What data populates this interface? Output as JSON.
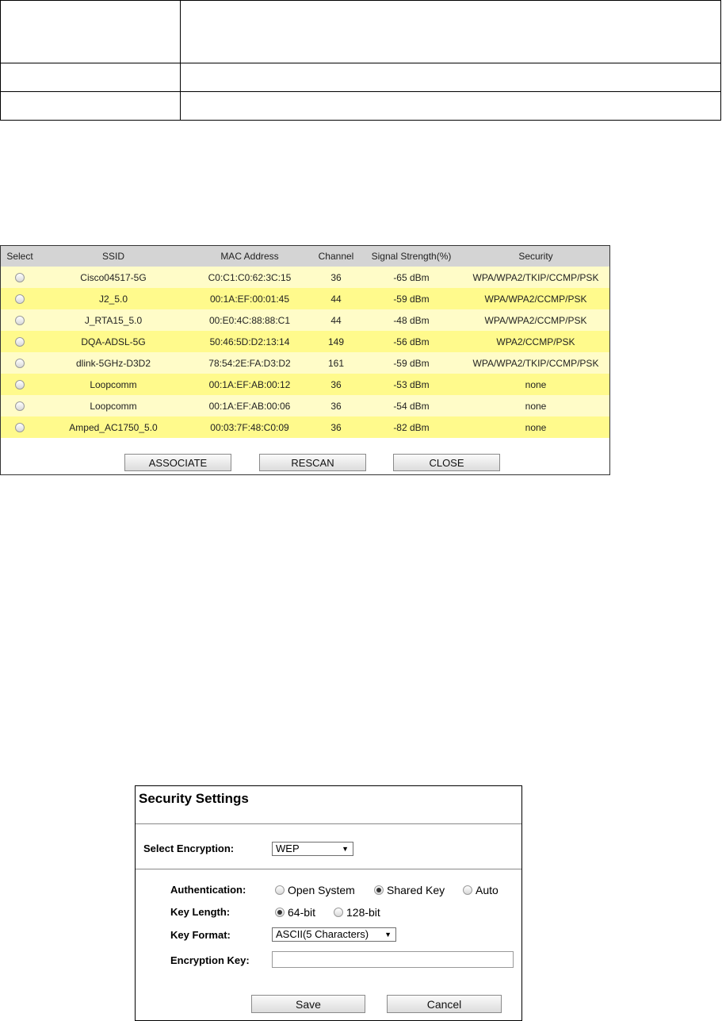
{
  "survey": {
    "columns": [
      "Select",
      "SSID",
      "MAC Address",
      "Channel",
      "Signal Strength(%)",
      "Security"
    ],
    "rows": [
      {
        "ssid": "Cisco04517-5G",
        "mac": "C0:C1:C0:62:3C:15",
        "channel": "36",
        "signal": "-65 dBm",
        "security": "WPA/WPA2/TKIP/CCMP/PSK"
      },
      {
        "ssid": "J2_5.0",
        "mac": "00:1A:EF:00:01:45",
        "channel": "44",
        "signal": "-59 dBm",
        "security": "WPA/WPA2/CCMP/PSK"
      },
      {
        "ssid": "J_RTA15_5.0",
        "mac": "00:E0:4C:88:88:C1",
        "channel": "44",
        "signal": "-48 dBm",
        "security": "WPA/WPA2/CCMP/PSK"
      },
      {
        "ssid": "DQA-ADSL-5G",
        "mac": "50:46:5D:D2:13:14",
        "channel": "149",
        "signal": "-56 dBm",
        "security": "WPA2/CCMP/PSK"
      },
      {
        "ssid": "dlink-5GHz-D3D2",
        "mac": "78:54:2E:FA:D3:D2",
        "channel": "161",
        "signal": "-59 dBm",
        "security": "WPA/WPA2/TKIP/CCMP/PSK"
      },
      {
        "ssid": "Loopcomm",
        "mac": "00:1A:EF:AB:00:12",
        "channel": "36",
        "signal": "-53 dBm",
        "security": "none"
      },
      {
        "ssid": "Loopcomm",
        "mac": "00:1A:EF:AB:00:06",
        "channel": "36",
        "signal": "-54 dBm",
        "security": "none"
      },
      {
        "ssid": "Amped_AC1750_5.0",
        "mac": "00:03:7F:48:C0:09",
        "channel": "36",
        "signal": "-82 dBm",
        "security": "none"
      }
    ],
    "buttons": {
      "associate": "ASSOCIATE",
      "rescan": "RESCAN",
      "close": "CLOSE"
    }
  },
  "security": {
    "title": "Security Settings",
    "encryption_label": "Select Encryption:",
    "encryption_value": "WEP",
    "authentication_label": "Authentication:",
    "auth_options": [
      "Open System",
      "Shared Key",
      "Auto"
    ],
    "auth_selected": "Shared Key",
    "key_length_label": "Key Length:",
    "key_length_options": [
      "64-bit",
      "128-bit"
    ],
    "key_length_selected": "64-bit",
    "key_format_label": "Key Format:",
    "key_format_value": "ASCII(5 Characters)",
    "encryption_key_label": "Encryption Key:",
    "encryption_key_value": "",
    "save_label": "Save",
    "cancel_label": "Cancel"
  },
  "icons": {
    "radio": "radio-icon",
    "dropdown": "dropdown-arrow-icon"
  }
}
